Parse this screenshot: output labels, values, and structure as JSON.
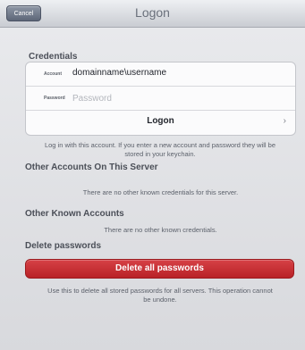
{
  "navbar": {
    "cancel_label": "Cancel",
    "title": "Logon"
  },
  "credentials": {
    "header": "Credentials",
    "account_label": "Account",
    "account_value": "domainname\\username",
    "password_label": "Password",
    "password_placeholder": "Password",
    "logon_label": "Logon",
    "chevron": "›",
    "note": "Log in with this account. If you enter a new account and password they will be stored in your keychain."
  },
  "other_accounts_server": {
    "header": "Other Accounts On This Server",
    "note": "There are no other known credentials for this server."
  },
  "other_known_accounts": {
    "header": "Other Known Accounts",
    "note": "There are no other known credentials."
  },
  "delete_passwords": {
    "header": "Delete passwords",
    "button_label": "Delete all passwords",
    "note": "Use this to delete all stored passwords for all servers. This operation cannot be undone."
  },
  "colors": {
    "navbar_bg": "#dfe1e5",
    "cancel_button": "#6f788a",
    "delete_button": "#c8282d",
    "background": "#dfe0e4"
  }
}
